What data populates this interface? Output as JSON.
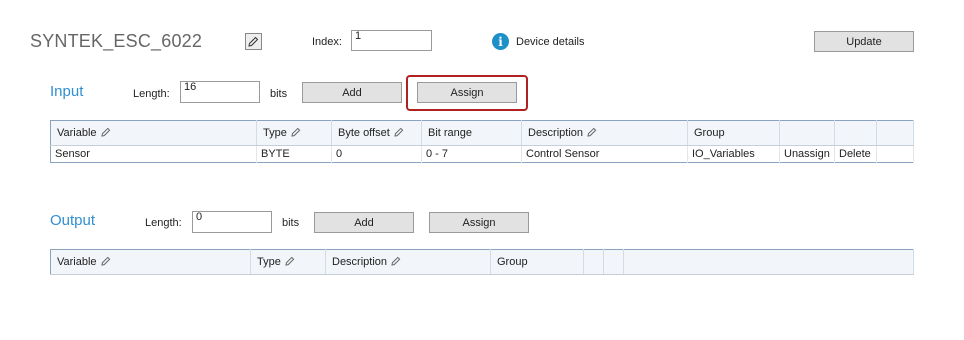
{
  "device": {
    "name": "SYNTEK_ESC_6022",
    "index_label": "Index:",
    "index_value": "1",
    "details_label": "Device details",
    "update_label": "Update"
  },
  "input": {
    "title": "Input",
    "length_label": "Length:",
    "length_value": "16",
    "unit": "bits",
    "add_label": "Add",
    "assign_label": "Assign",
    "columns": [
      "Variable",
      "Type",
      "Byte offset",
      "Bit range",
      "Description",
      "Group"
    ],
    "rows": [
      {
        "variable": "Sensor",
        "type": "BYTE",
        "byte_offset": "0",
        "bit_range": "0 - 7",
        "description": "Control Sensor",
        "group": "IO_Variables",
        "unassign": "Unassign",
        "delete": "Delete"
      }
    ]
  },
  "output": {
    "title": "Output",
    "length_label": "Length:",
    "length_value": "0",
    "unit": "bits",
    "add_label": "Add",
    "assign_label": "Assign",
    "columns": [
      "Variable",
      "Type",
      "Description",
      "Group"
    ]
  },
  "colors": {
    "accent": "#2f8fd0",
    "highlight": "#b02121",
    "link": "#1f6fb5"
  }
}
